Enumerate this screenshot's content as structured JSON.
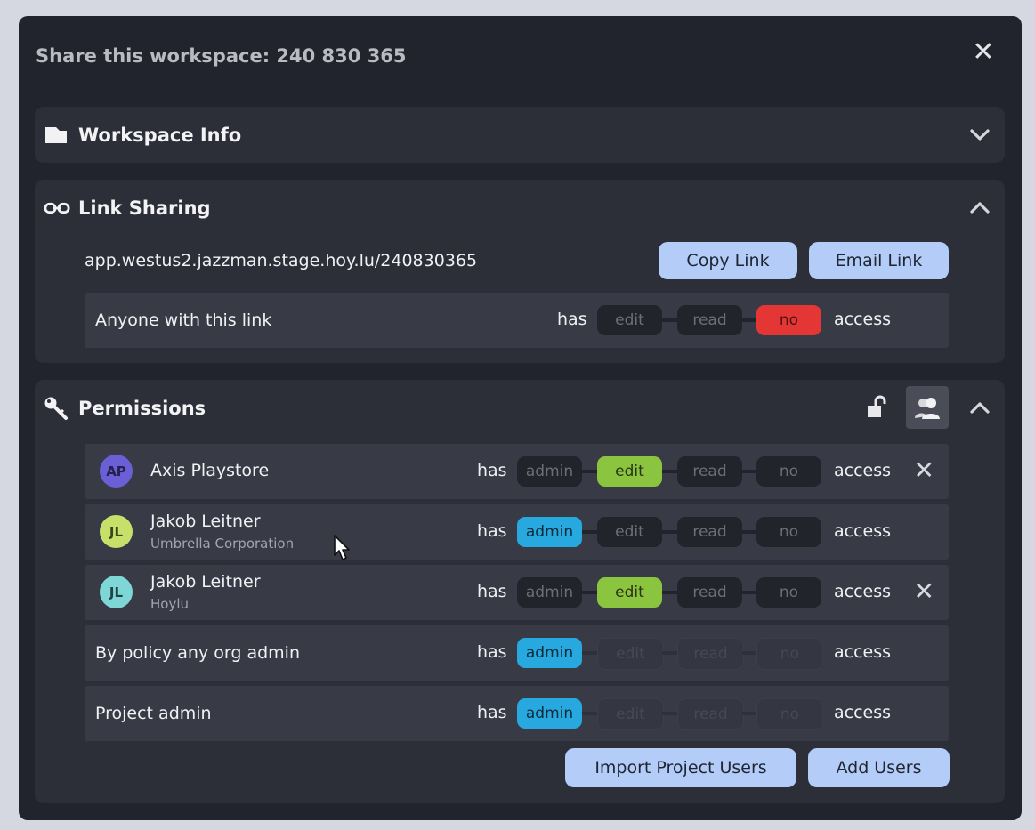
{
  "dialog": {
    "title": "Share this workspace: 240 830 365",
    "close_icon": "close-icon"
  },
  "workspace_info": {
    "label": "Workspace Info",
    "icon": "folder-icon",
    "expanded": false
  },
  "link_sharing": {
    "label": "Link Sharing",
    "icon": "link-icon",
    "expanded": true,
    "url": "app.westus2.jazzman.stage.hoy.lu/240830365",
    "copy_label": "Copy Link",
    "email_label": "Email Link",
    "anyone": {
      "label": "Anyone with this link",
      "has": "has",
      "options": [
        "edit",
        "read",
        "no"
      ],
      "selected": "no",
      "access": "access"
    }
  },
  "permissions": {
    "label": "Permissions",
    "icon": "key-icon",
    "lock_icon": "unlock-icon",
    "users_icon": "users-icon",
    "expanded": true,
    "options": [
      "admin",
      "edit",
      "read",
      "no"
    ],
    "has": "has",
    "access": "access",
    "rows": [
      {
        "initials": "AP",
        "name": "Axis Playstore",
        "org": "",
        "selected": "edit",
        "removable": true,
        "avatar_color": "#6b5fd6"
      },
      {
        "initials": "JL",
        "name": "Jakob Leitner",
        "org": "Umbrella Corporation",
        "selected": "admin",
        "removable": false,
        "avatar_color": "#c7e06a"
      },
      {
        "initials": "JL",
        "name": "Jakob Leitner",
        "org": "Hoylu",
        "selected": "edit",
        "removable": true,
        "avatar_color": "#7ed7d6"
      },
      {
        "initials": "",
        "name": "By policy any org admin",
        "org": "",
        "selected": "admin",
        "removable": false,
        "locked": true
      },
      {
        "initials": "",
        "name": "Project admin",
        "org": "",
        "selected": "admin",
        "removable": false,
        "locked": true
      }
    ],
    "import_label": "Import Project Users",
    "add_label": "Add Users"
  },
  "colors": {
    "accent_button": "#b3cdf8",
    "edit_green": "#8bc540",
    "admin_blue": "#27a8de",
    "no_red": "#e53636"
  }
}
